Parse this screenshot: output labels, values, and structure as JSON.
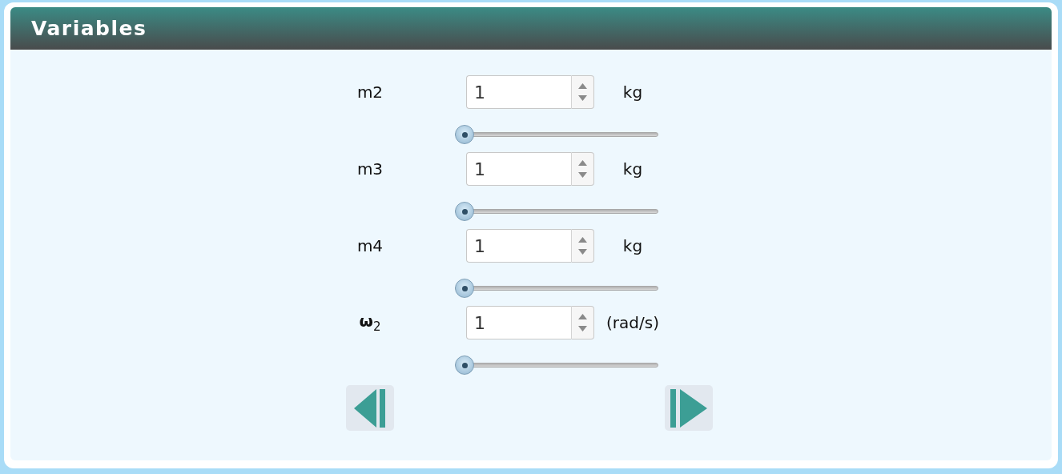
{
  "panel": {
    "title": "Variables"
  },
  "variables": [
    {
      "label": "m2",
      "value": "1",
      "unit": "kg",
      "level": 0
    },
    {
      "label": "m3",
      "value": "1",
      "unit": "kg",
      "level": 0
    },
    {
      "label": "m4",
      "value": "1",
      "unit": "kg",
      "level": 0
    },
    {
      "label": "**ω**$_{2}$",
      "value": "1",
      "unit": "(rad/s)",
      "level": 0
    }
  ],
  "nav_buttons": [
    {
      "kind": "previous"
    },
    {
      "kind": "next"
    }
  ]
}
